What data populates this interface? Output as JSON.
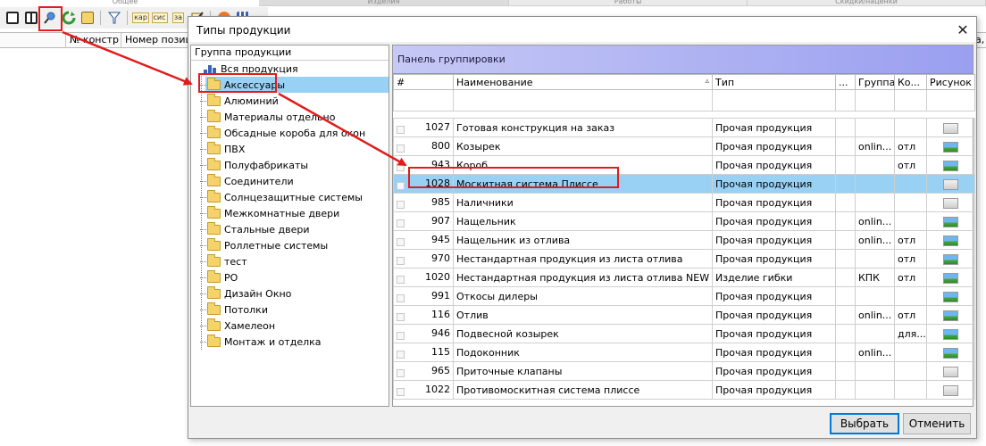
{
  "background": {
    "tab_left": "Общее",
    "tabs": [
      "Изделия",
      "Работы",
      "Скидки/наценки"
    ],
    "columns": [
      "№ констр",
      "Номер позици"
    ],
    "right_fragment": "а,"
  },
  "toolbar": {
    "icons": [
      "window-icon",
      "window-split-icon",
      "search-user-icon",
      "refresh-icon",
      "clipboard-icon",
      "filter-icon",
      "calc-icon",
      "calc-icon",
      "calc-icon",
      "edit-icon",
      "stop-icon",
      "grid-icon"
    ],
    "labels": [
      "кар",
      "сис",
      "за"
    ]
  },
  "dialog": {
    "title": "Типы продукции",
    "close_label": "✕",
    "tree": {
      "header": "Группа продукции",
      "root": "Вся продукция",
      "items": [
        "Аксессуары",
        "Алюминий",
        "Материалы отдельно",
        "Обсадные короба для окон",
        "ПВХ",
        "Полуфабрикаты",
        "Соединители",
        "Солнцезащитные системы",
        "Межкомнатные двери",
        "Стальные двери",
        "Роллетные системы",
        "тест",
        "РО",
        "Дизайн Окно",
        "Потолки",
        "Хамелеон",
        "Монтаж и отделка"
      ],
      "selected_index": 0
    },
    "grid": {
      "group_panel": "Панель группировки",
      "columns": [
        "#",
        "Наименование",
        "Тип",
        "...",
        "Группа",
        "Ко...",
        "Рисунок"
      ],
      "sort_indicator": "▵",
      "rows": [
        {
          "id": "1027",
          "name": "Готовая конструкция на заказ",
          "type": "Прочая продукция",
          "group": "",
          "ko": "",
          "pic": "blank"
        },
        {
          "id": "800",
          "name": "Козырек",
          "type": "Прочая продукция",
          "group": "onlin...",
          "ko": "отл",
          "pic": "img"
        },
        {
          "id": "943",
          "name": "Короб",
          "type": "Прочая продукция",
          "group": "",
          "ko": "отл",
          "pic": "img"
        },
        {
          "id": "1028",
          "name": "Москитная система Плиссе",
          "type": "Прочая продукция",
          "group": "",
          "ko": "",
          "pic": "blank"
        },
        {
          "id": "985",
          "name": "Наличники",
          "type": "Прочая продукция",
          "group": "",
          "ko": "",
          "pic": "blank"
        },
        {
          "id": "907",
          "name": "Нащельник",
          "type": "Прочая продукция",
          "group": "onlin...",
          "ko": "",
          "pic": "img"
        },
        {
          "id": "945",
          "name": "Нащельник из отлива",
          "type": "Прочая продукция",
          "group": "onlin...",
          "ko": "отл",
          "pic": "img"
        },
        {
          "id": "970",
          "name": "Нестандартная продукция из листа отлива",
          "type": "Прочая продукция",
          "group": "",
          "ko": "отл",
          "pic": "img"
        },
        {
          "id": "1020",
          "name": "Нестандартная продукция из листа отлива NEW",
          "type": "Изделие гибки",
          "group": "КПК",
          "ko": "отл",
          "pic": "img"
        },
        {
          "id": "991",
          "name": "Откосы дилеры",
          "type": "Прочая продукция",
          "group": "",
          "ko": "",
          "pic": "img"
        },
        {
          "id": "116",
          "name": "Отлив",
          "type": "Прочая продукция",
          "group": "onlin...",
          "ko": "отл",
          "pic": "img"
        },
        {
          "id": "946",
          "name": "Подвесной козырек",
          "type": "Прочая продукция",
          "group": "",
          "ko": "для...",
          "pic": "img"
        },
        {
          "id": "115",
          "name": "Подоконник",
          "type": "Прочая продукция",
          "group": "onlin...",
          "ko": "",
          "pic": "img"
        },
        {
          "id": "965",
          "name": "Приточные клапаны",
          "type": "Прочая продукция",
          "group": "",
          "ko": "",
          "pic": "blank"
        },
        {
          "id": "1022",
          "name": "Противомоскитная система плиссе",
          "type": "Прочая продукция",
          "group": "",
          "ko": "",
          "pic": "blank"
        }
      ],
      "selected_index": 3
    },
    "buttons": {
      "ok": "Выбрать",
      "cancel": "Отменить"
    }
  },
  "colors": {
    "highlight": "#e21b1b",
    "selection": "#99d1f5",
    "group_panel": "#9a9ff0"
  }
}
